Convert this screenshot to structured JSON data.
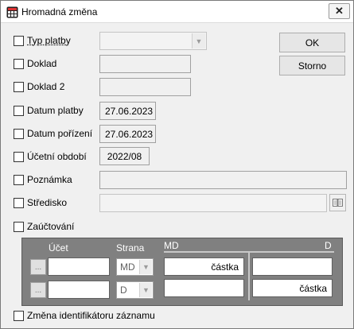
{
  "window": {
    "title": "Hromadná změna",
    "close_glyph": "✕",
    "icon": "grid-app-icon"
  },
  "fields": {
    "typ_platby": {
      "label": "Typ platby",
      "value": ""
    },
    "doklad": {
      "label": "Doklad",
      "value": ""
    },
    "doklad2": {
      "label": "Doklad 2",
      "value": ""
    },
    "datum_platby": {
      "label": "Datum platby",
      "value": "27.06.2023"
    },
    "datum_porizeni": {
      "label": "Datum pořízení",
      "value": "27.06.2023"
    },
    "ucetni_obdobi": {
      "label": "Účetní období",
      "value": "2022/08"
    },
    "poznamka": {
      "label": "Poznámka",
      "value": ""
    },
    "stredisko": {
      "label": "Středisko",
      "value": ""
    },
    "zauctovani": {
      "label": "Zaúčtování"
    },
    "zmena_id": {
      "label": "Změna identifikátoru záznamu"
    }
  },
  "buttons": {
    "ok": "OK",
    "storno": "Storno"
  },
  "posting": {
    "ucet_label": "Účet",
    "strana_label": "Strana",
    "md_label": "MD",
    "d_label": "D",
    "ellipsis": "...",
    "rows": [
      {
        "ucet": "",
        "strana": "MD",
        "md": "částka",
        "d": ""
      },
      {
        "ucet": "",
        "strana": "D",
        "md": "",
        "d": "částka"
      }
    ]
  }
}
